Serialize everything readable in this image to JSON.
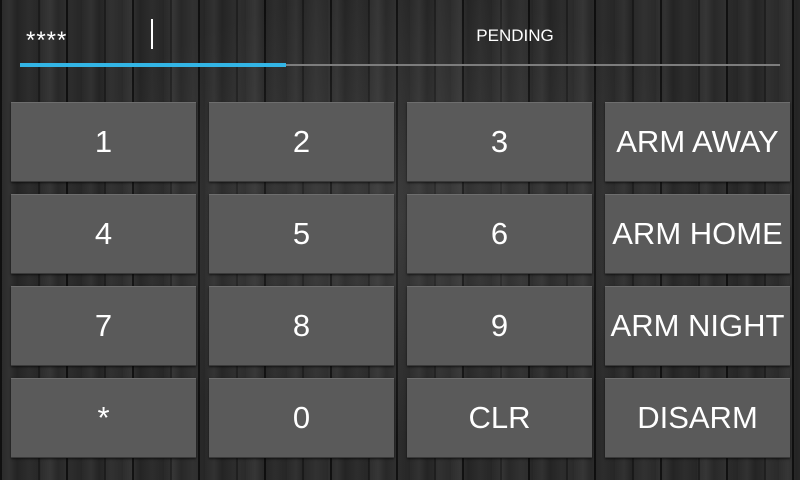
{
  "display": {
    "code": "****",
    "status": "PENDING",
    "progress_fraction": 0.35,
    "accent_color": "#33b5e5"
  },
  "keypad": {
    "keys": [
      {
        "label": "1",
        "name": "key-1"
      },
      {
        "label": "2",
        "name": "key-2"
      },
      {
        "label": "3",
        "name": "key-3"
      },
      {
        "label": "ARM AWAY",
        "name": "arm-away-button"
      },
      {
        "label": "4",
        "name": "key-4"
      },
      {
        "label": "5",
        "name": "key-5"
      },
      {
        "label": "6",
        "name": "key-6"
      },
      {
        "label": "ARM HOME",
        "name": "arm-home-button"
      },
      {
        "label": "7",
        "name": "key-7"
      },
      {
        "label": "8",
        "name": "key-8"
      },
      {
        "label": "9",
        "name": "key-9"
      },
      {
        "label": "ARM NIGHT",
        "name": "arm-night-button"
      },
      {
        "label": "*",
        "name": "key-star"
      },
      {
        "label": "0",
        "name": "key-0"
      },
      {
        "label": "CLR",
        "name": "clear-button"
      },
      {
        "label": "DISARM",
        "name": "disarm-button"
      }
    ]
  }
}
